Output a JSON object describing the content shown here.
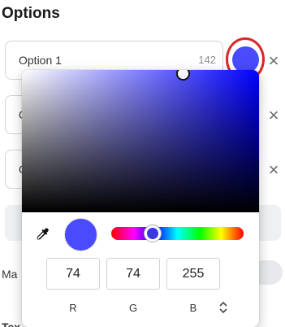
{
  "form": {
    "section_title": "Options",
    "options": [
      {
        "value": "Option 1",
        "count": "142"
      },
      {
        "value": "O",
        "count": ""
      },
      {
        "value": "O",
        "count": ""
      }
    ],
    "remove_icon": "×",
    "label_partial_1": "Ma",
    "label_partial_2": "Tex"
  },
  "picker": {
    "selected_color": "#4a4aff",
    "r": "74",
    "g": "74",
    "b": "255",
    "r_label": "R",
    "g_label": "G",
    "b_label": "B",
    "mode_toggle_icon": "⌃⌄",
    "hue_fraction": 0.333,
    "saturation": 0.71,
    "value": 1.0
  },
  "icons": {
    "eyedropper": "eyedropper-icon",
    "remove": "close-icon"
  }
}
